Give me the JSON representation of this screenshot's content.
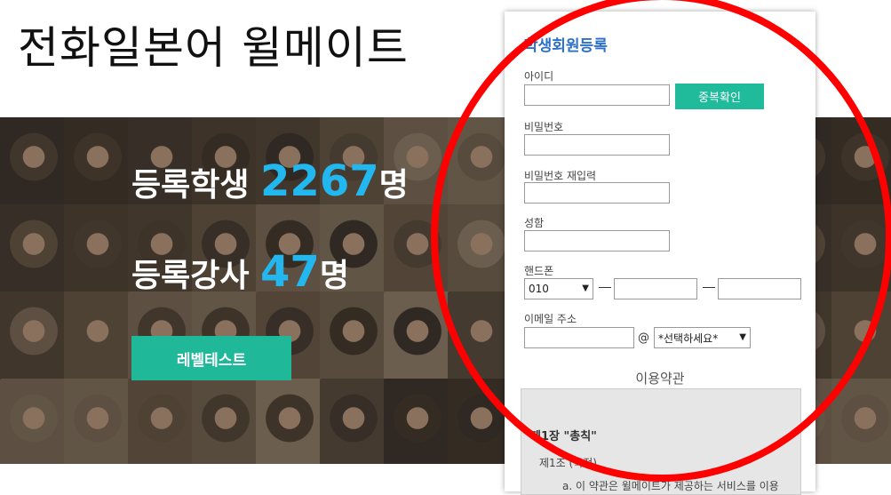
{
  "site": {
    "title": "전화일본어 윌메이트"
  },
  "hero": {
    "students_label": "등록학생 ",
    "students_count": "2267",
    "students_unit": "명",
    "teachers_label": "등록강사 ",
    "teachers_count": "47",
    "teachers_unit": "명",
    "level_test_button": "레벨테스트"
  },
  "signup": {
    "title": "학생회원등록",
    "id_label": "아이디",
    "id_value": "",
    "duplicate_check_button": "중복확인",
    "password_label": "비밀번호",
    "password_confirm_label": "비밀번호 재입력",
    "name_label": "성함",
    "phone_label": "핸드폰",
    "phone_prefix_selected": "010",
    "email_label": "이메일 주소",
    "email_at": "@",
    "email_domain_selected": "*선택하세요*"
  },
  "terms": {
    "title": "이용약관",
    "chapter": "제1장 \"총칙\"",
    "article": "제1조 (목적)",
    "first_line": "a. 이 약관은 윌메이트가 제공하는 서비스를 이용"
  },
  "colors": {
    "accent_green": "#1fb999",
    "stat_number_blue": "#22b8ef",
    "title_blue": "#2b6fc9",
    "highlight_circle": "#ff0000"
  }
}
